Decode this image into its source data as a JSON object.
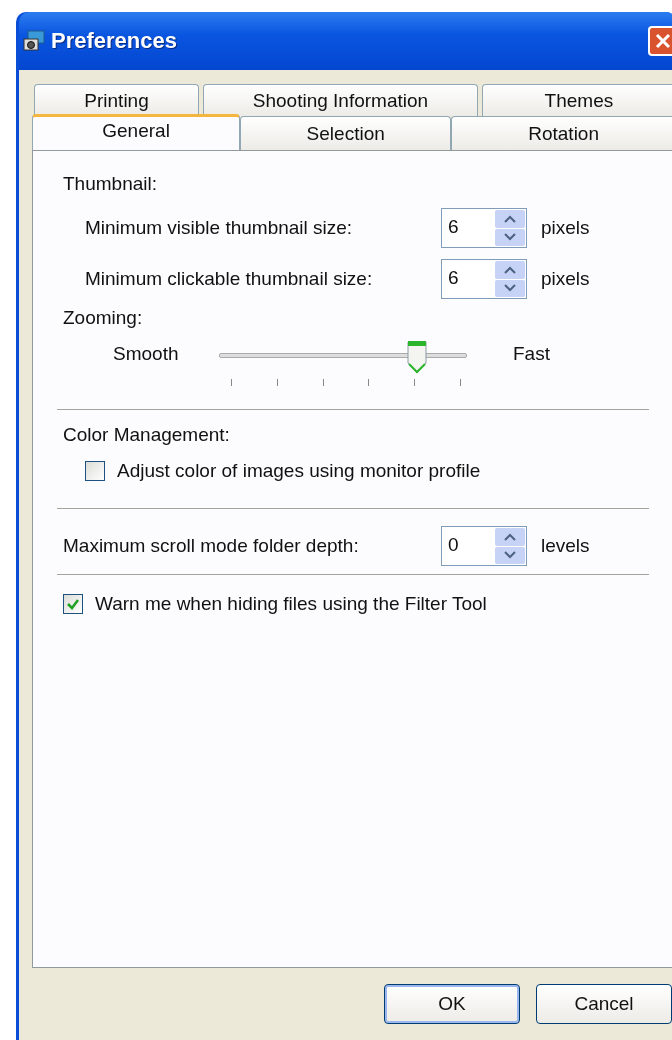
{
  "window": {
    "title": "Preferences"
  },
  "tab_rows": [
    {
      "tabs": [
        {
          "label": "Printing",
          "selected": false
        },
        {
          "label": "Shooting Information",
          "selected": false
        },
        {
          "label": "Themes",
          "selected": false
        }
      ]
    },
    {
      "tabs": [
        {
          "label": "General",
          "selected": true
        },
        {
          "label": "Selection",
          "selected": false
        },
        {
          "label": "Rotation",
          "selected": false
        }
      ]
    }
  ],
  "thumbnail": {
    "heading": "Thumbnail:",
    "fields": [
      {
        "label": "Minimum visible thumbnail size:",
        "value": "6",
        "unit": "pixels"
      },
      {
        "label": "Minimum clickable thumbnail size:",
        "value": "6",
        "unit": "pixels"
      }
    ]
  },
  "zooming": {
    "heading": "Zooming:",
    "min_label": "Smooth",
    "max_label": "Fast",
    "level": 0.8
  },
  "color_management": {
    "heading": "Color Management:",
    "checkbox": {
      "label": "Adjust color of images using monitor profile",
      "checked": false
    }
  },
  "folder_depth": {
    "label": "Maximum scroll mode folder depth:",
    "value": "0",
    "unit": "levels"
  },
  "filter_warning": {
    "label": "Warn me when hiding files using the Filter Tool",
    "checked": true
  },
  "buttons": [
    {
      "label": "OK",
      "default": true
    },
    {
      "label": "Cancel",
      "default": false
    }
  ]
}
